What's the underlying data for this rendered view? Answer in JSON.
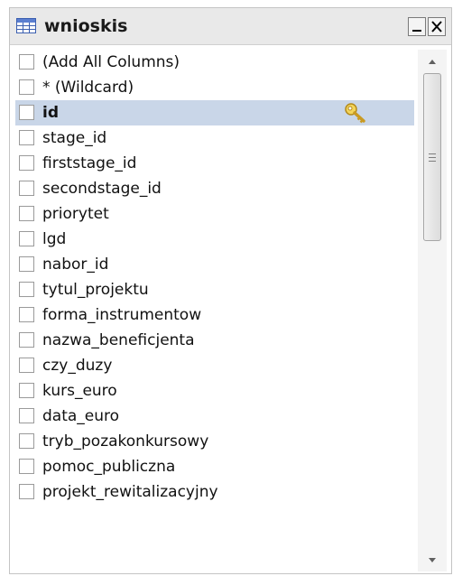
{
  "window": {
    "title": "wnioskis",
    "icons": {
      "table": "table-icon",
      "minimize": "minimize-icon",
      "close": "close-icon",
      "primary_key": "key-icon"
    }
  },
  "columns": [
    {
      "label": "(Add All Columns)",
      "checked": false
    },
    {
      "label": "* (Wildcard)",
      "checked": false
    },
    {
      "label": "id",
      "checked": false,
      "primary_key": true,
      "selected": true
    },
    {
      "label": "stage_id",
      "checked": false
    },
    {
      "label": "firststage_id",
      "checked": false
    },
    {
      "label": "secondstage_id",
      "checked": false
    },
    {
      "label": "priorytet",
      "checked": false
    },
    {
      "label": "lgd",
      "checked": false
    },
    {
      "label": "nabor_id",
      "checked": false
    },
    {
      "label": "tytul_projektu",
      "checked": false
    },
    {
      "label": "forma_instrumentow",
      "checked": false
    },
    {
      "label": "nazwa_beneficjenta",
      "checked": false
    },
    {
      "label": "czy_duzy",
      "checked": false
    },
    {
      "label": "kurs_euro",
      "checked": false
    },
    {
      "label": "data_euro",
      "checked": false
    },
    {
      "label": "tryb_pozakonkursowy",
      "checked": false
    },
    {
      "label": "pomoc_publiczna",
      "checked": false
    },
    {
      "label": "projekt_rewitalizacyjny",
      "checked": false
    }
  ],
  "colors": {
    "selection": "#c9d6e8",
    "titlebar": "#e9e9e9"
  }
}
